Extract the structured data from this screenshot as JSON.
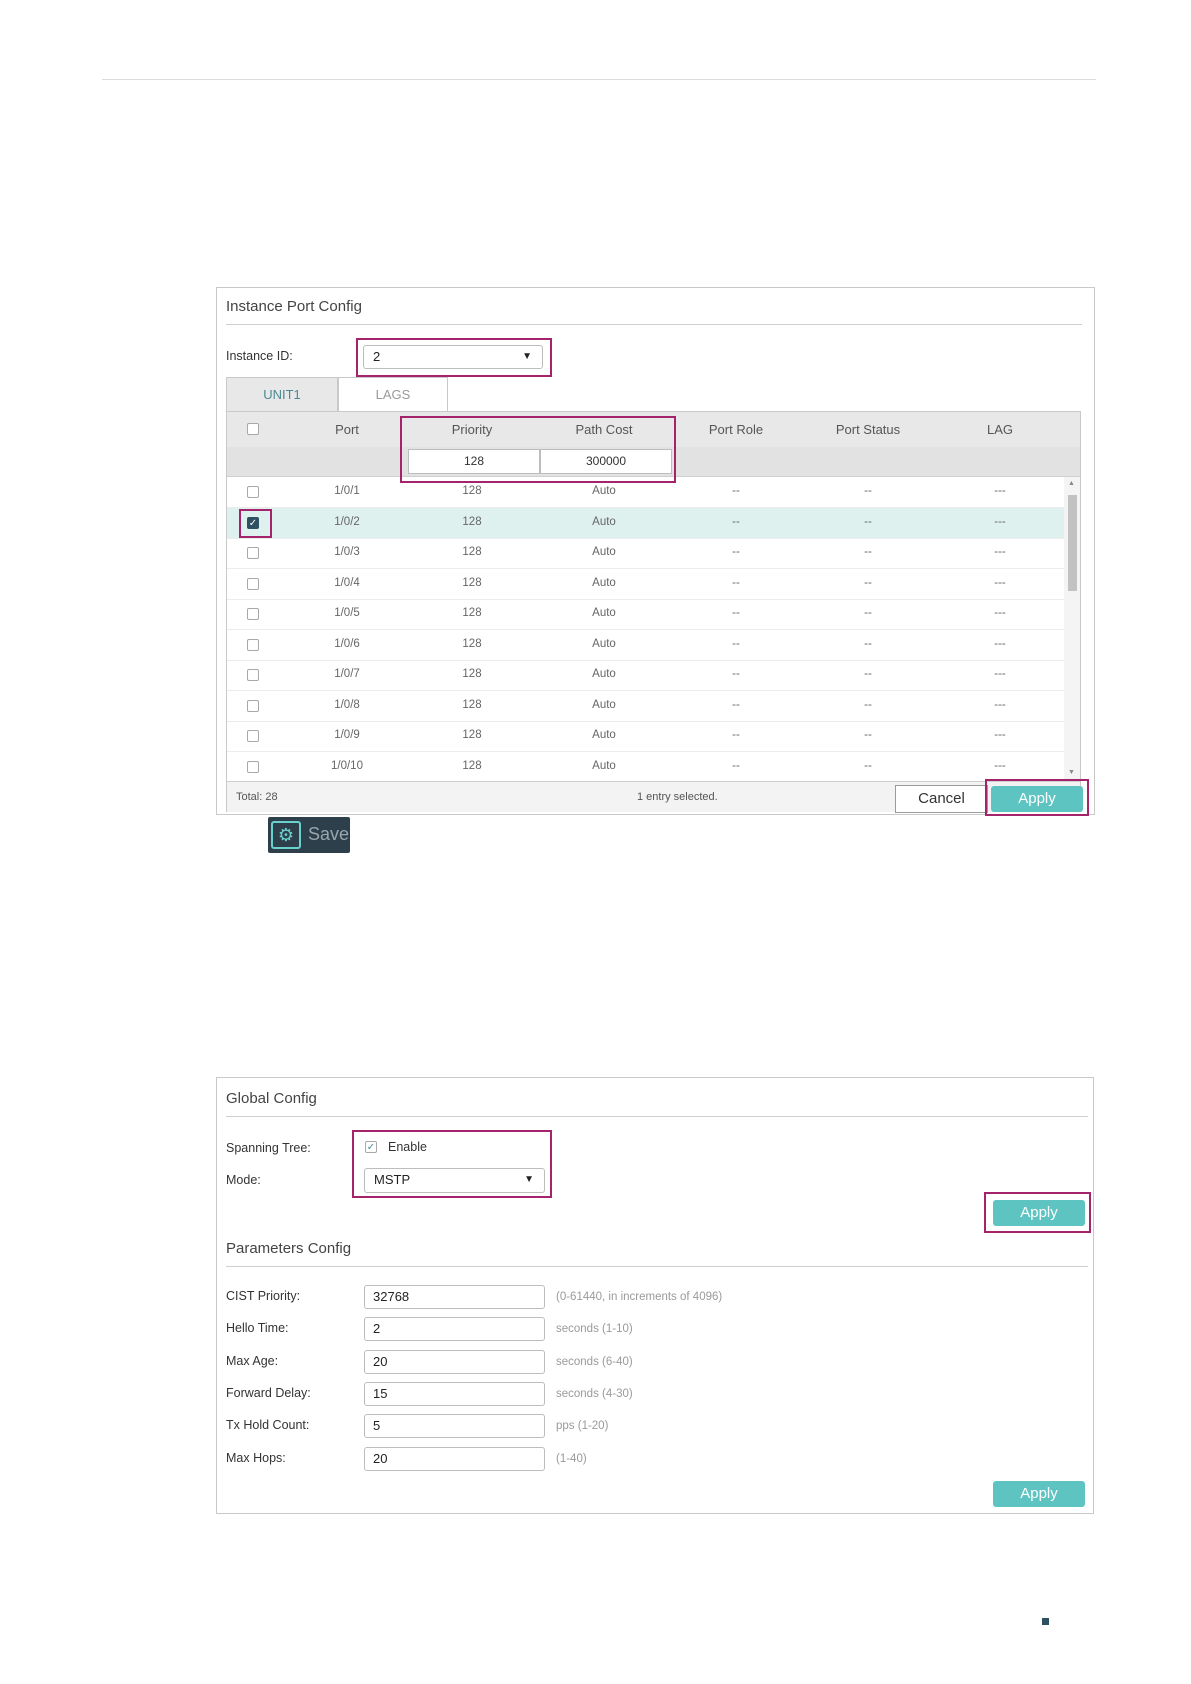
{
  "instance_panel": {
    "title": "Instance Port Config",
    "instance_id_label": "Instance ID:",
    "instance_id_value": "2",
    "tabs": [
      {
        "label": "UNIT1",
        "active": true
      },
      {
        "label": "LAGS",
        "active": false
      }
    ],
    "columns": [
      "Port",
      "Priority",
      "Path Cost",
      "Port Role",
      "Port Status",
      "LAG"
    ],
    "edit_row": {
      "priority": "128",
      "path_cost": "300000"
    },
    "rows": [
      {
        "port": "1/0/1",
        "priority": "128",
        "path_cost": "Auto",
        "role": "--",
        "status": "--",
        "lag": "---",
        "checked": false
      },
      {
        "port": "1/0/2",
        "priority": "128",
        "path_cost": "Auto",
        "role": "--",
        "status": "--",
        "lag": "---",
        "checked": true
      },
      {
        "port": "1/0/3",
        "priority": "128",
        "path_cost": "Auto",
        "role": "--",
        "status": "--",
        "lag": "---",
        "checked": false
      },
      {
        "port": "1/0/4",
        "priority": "128",
        "path_cost": "Auto",
        "role": "--",
        "status": "--",
        "lag": "---",
        "checked": false
      },
      {
        "port": "1/0/5",
        "priority": "128",
        "path_cost": "Auto",
        "role": "--",
        "status": "--",
        "lag": "---",
        "checked": false
      },
      {
        "port": "1/0/6",
        "priority": "128",
        "path_cost": "Auto",
        "role": "--",
        "status": "--",
        "lag": "---",
        "checked": false
      },
      {
        "port": "1/0/7",
        "priority": "128",
        "path_cost": "Auto",
        "role": "--",
        "status": "--",
        "lag": "---",
        "checked": false
      },
      {
        "port": "1/0/8",
        "priority": "128",
        "path_cost": "Auto",
        "role": "--",
        "status": "--",
        "lag": "---",
        "checked": false
      },
      {
        "port": "1/0/9",
        "priority": "128",
        "path_cost": "Auto",
        "role": "--",
        "status": "--",
        "lag": "---",
        "checked": false
      },
      {
        "port": "1/0/10",
        "priority": "128",
        "path_cost": "Auto",
        "role": "--",
        "status": "--",
        "lag": "---",
        "checked": false
      }
    ],
    "total_text": "Total: 28",
    "selected_text": "1 entry selected.",
    "cancel_label": "Cancel",
    "apply_label": "Apply"
  },
  "save_button": {
    "label": "Save",
    "icon": "gear-save-icon"
  },
  "global_panel": {
    "title": "Global Config",
    "spanning_tree_label": "Spanning Tree:",
    "enable_label": "Enable",
    "enable_checked": true,
    "mode_label": "Mode:",
    "mode_value": "MSTP",
    "apply_label": "Apply"
  },
  "params_panel": {
    "title": "Parameters Config",
    "fields": [
      {
        "label": "CIST Priority:",
        "value": "32768",
        "hint": "(0-61440, in increments of 4096)"
      },
      {
        "label": "Hello Time:",
        "value": "2",
        "hint": "seconds (1-10)"
      },
      {
        "label": "Max Age:",
        "value": "20",
        "hint": "seconds (6-40)"
      },
      {
        "label": "Forward Delay:",
        "value": "15",
        "hint": "seconds (4-30)"
      },
      {
        "label": "Tx Hold Count:",
        "value": "5",
        "hint": "pps (1-20)"
      },
      {
        "label": "Max Hops:",
        "value": "20",
        "hint": "(1-40)"
      }
    ],
    "apply_label": "Apply"
  },
  "colors": {
    "accent": "#5ec4c2",
    "highlight": "#a3246b",
    "selected_row": "#dff1ee",
    "dark": "#2f4f63"
  }
}
